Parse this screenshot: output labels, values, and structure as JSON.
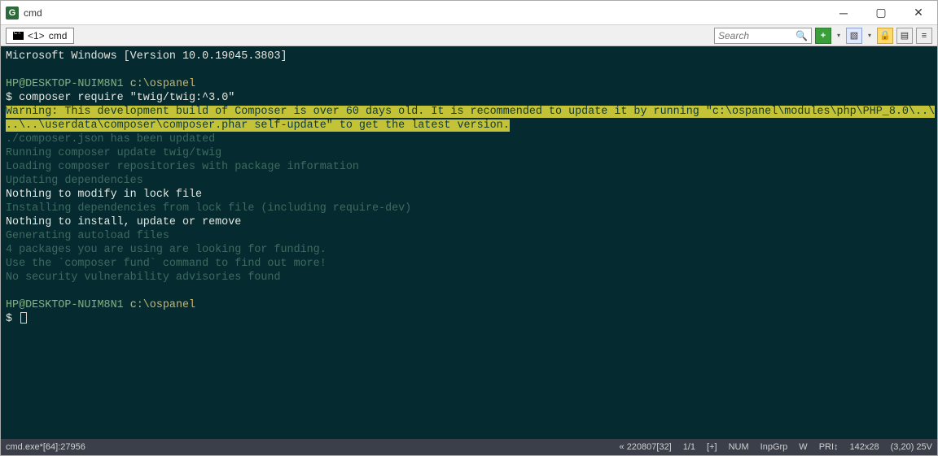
{
  "window": {
    "title": "cmd"
  },
  "tab": {
    "index_label": "<1>",
    "name": "cmd"
  },
  "search": {
    "placeholder": "Search"
  },
  "terminal": {
    "banner": "Microsoft Windows [Version 10.0.19045.3803]",
    "prompt_userhost": "HP@DESKTOP-NUIM8N1",
    "prompt_path": "c:\\ospanel",
    "prompt_symbol": "$",
    "command": "composer require \"twig/twig:^3.0\"",
    "warning_line1": "Warning: This development build of Composer is over 60 days old. It is recommended to update it by running \"c:\\ospanel\\modules\\php\\PHP_8.0\\..\\",
    "warning_line2": "..\\..\\userdata\\composer\\composer.phar self-update\" to get the latest version.",
    "out1": "./composer.json has been updated",
    "out2": "Running composer update twig/twig",
    "out3": "Loading composer repositories with package information",
    "out4": "Updating dependencies",
    "out5": "Nothing to modify in lock file",
    "out6": "Installing dependencies from lock file (including require-dev)",
    "out7": "Nothing to install, update or remove",
    "out8": "Generating autoload files",
    "out9": "4 packages you are using are looking for funding.",
    "out10": "Use the `composer fund` command to find out more!",
    "out11": "No security vulnerability advisories found"
  },
  "status": {
    "left": "cmd.exe*[64]:27956",
    "r1": "« 220807[32]",
    "r2": "1/1",
    "r3": "[+]",
    "r4": "NUM",
    "r5": "InpGrp",
    "r6": "W",
    "r7": "PRI↕",
    "r8": "142x28",
    "r9": "(3,20) 25V"
  }
}
